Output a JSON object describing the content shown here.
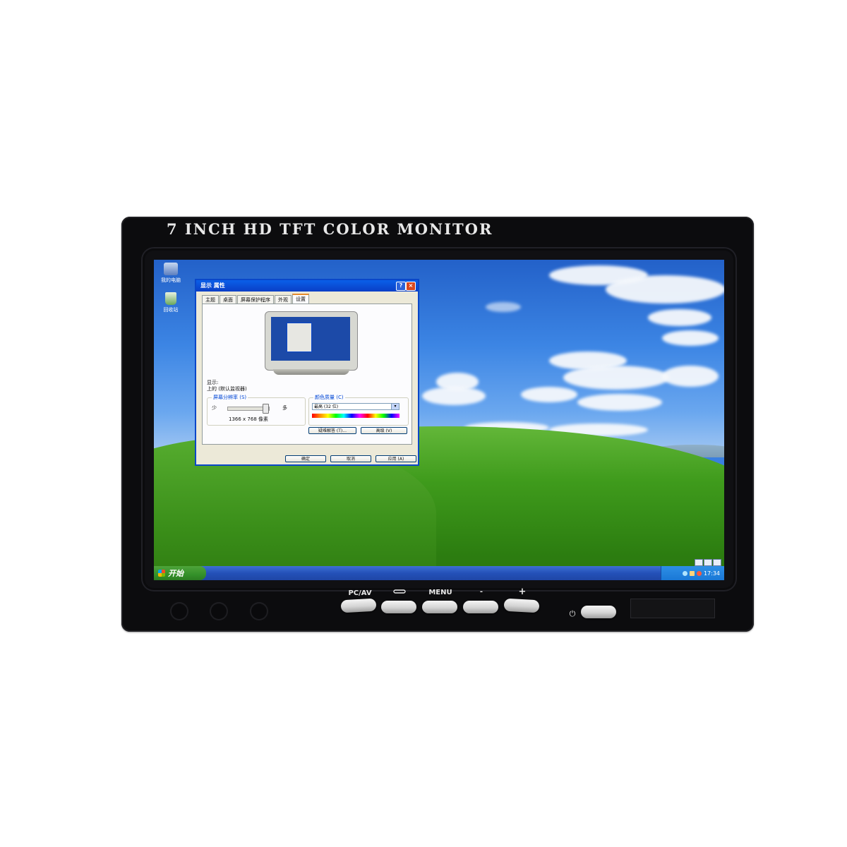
{
  "monitor": {
    "brand_text": "7 INCH HD TFT COLOR MONITOR",
    "buttons": [
      {
        "label": "PC/AV",
        "icon": ""
      },
      {
        "label": "",
        "icon": "input-swap-icon"
      },
      {
        "label": "MENU",
        "icon": ""
      },
      {
        "label": "-",
        "icon": ""
      },
      {
        "label": "+",
        "icon": ""
      }
    ],
    "power_icon": "⏻"
  },
  "desktop": {
    "icons": [
      {
        "label": "我的电脑",
        "icon": "my-computer-icon"
      },
      {
        "label": "回收站",
        "icon": "recycle-bin-icon"
      }
    ],
    "taskbar": {
      "start_label": "开始",
      "clock": "17:34"
    }
  },
  "dialog": {
    "title": "显示 属性",
    "help_btn": "?",
    "close_btn": "×",
    "tabs": [
      "主题",
      "桌面",
      "屏幕保护程序",
      "外观",
      "设置"
    ],
    "active_tab": "设置",
    "display_label": "显示:",
    "display_value": "上的 (默认监视器)",
    "resolution": {
      "title": "屏幕分辨率 (S)",
      "less": "少",
      "more": "多",
      "value": "1366 x 768 像素",
      "slider_level": 0.85
    },
    "color": {
      "title": "颜色质量 (C)",
      "selected": "最高 (32 位)"
    },
    "troubleshoot_btn": "疑难解答 (T)...",
    "advanced_btn": "高级 (V)",
    "ok_btn": "确定",
    "cancel_btn": "取消",
    "apply_btn": "应用 (A)"
  },
  "colors": {
    "xp_blue": "#0a47c9",
    "xp_green": "#34912a",
    "bezel": "#0c0c0e"
  }
}
